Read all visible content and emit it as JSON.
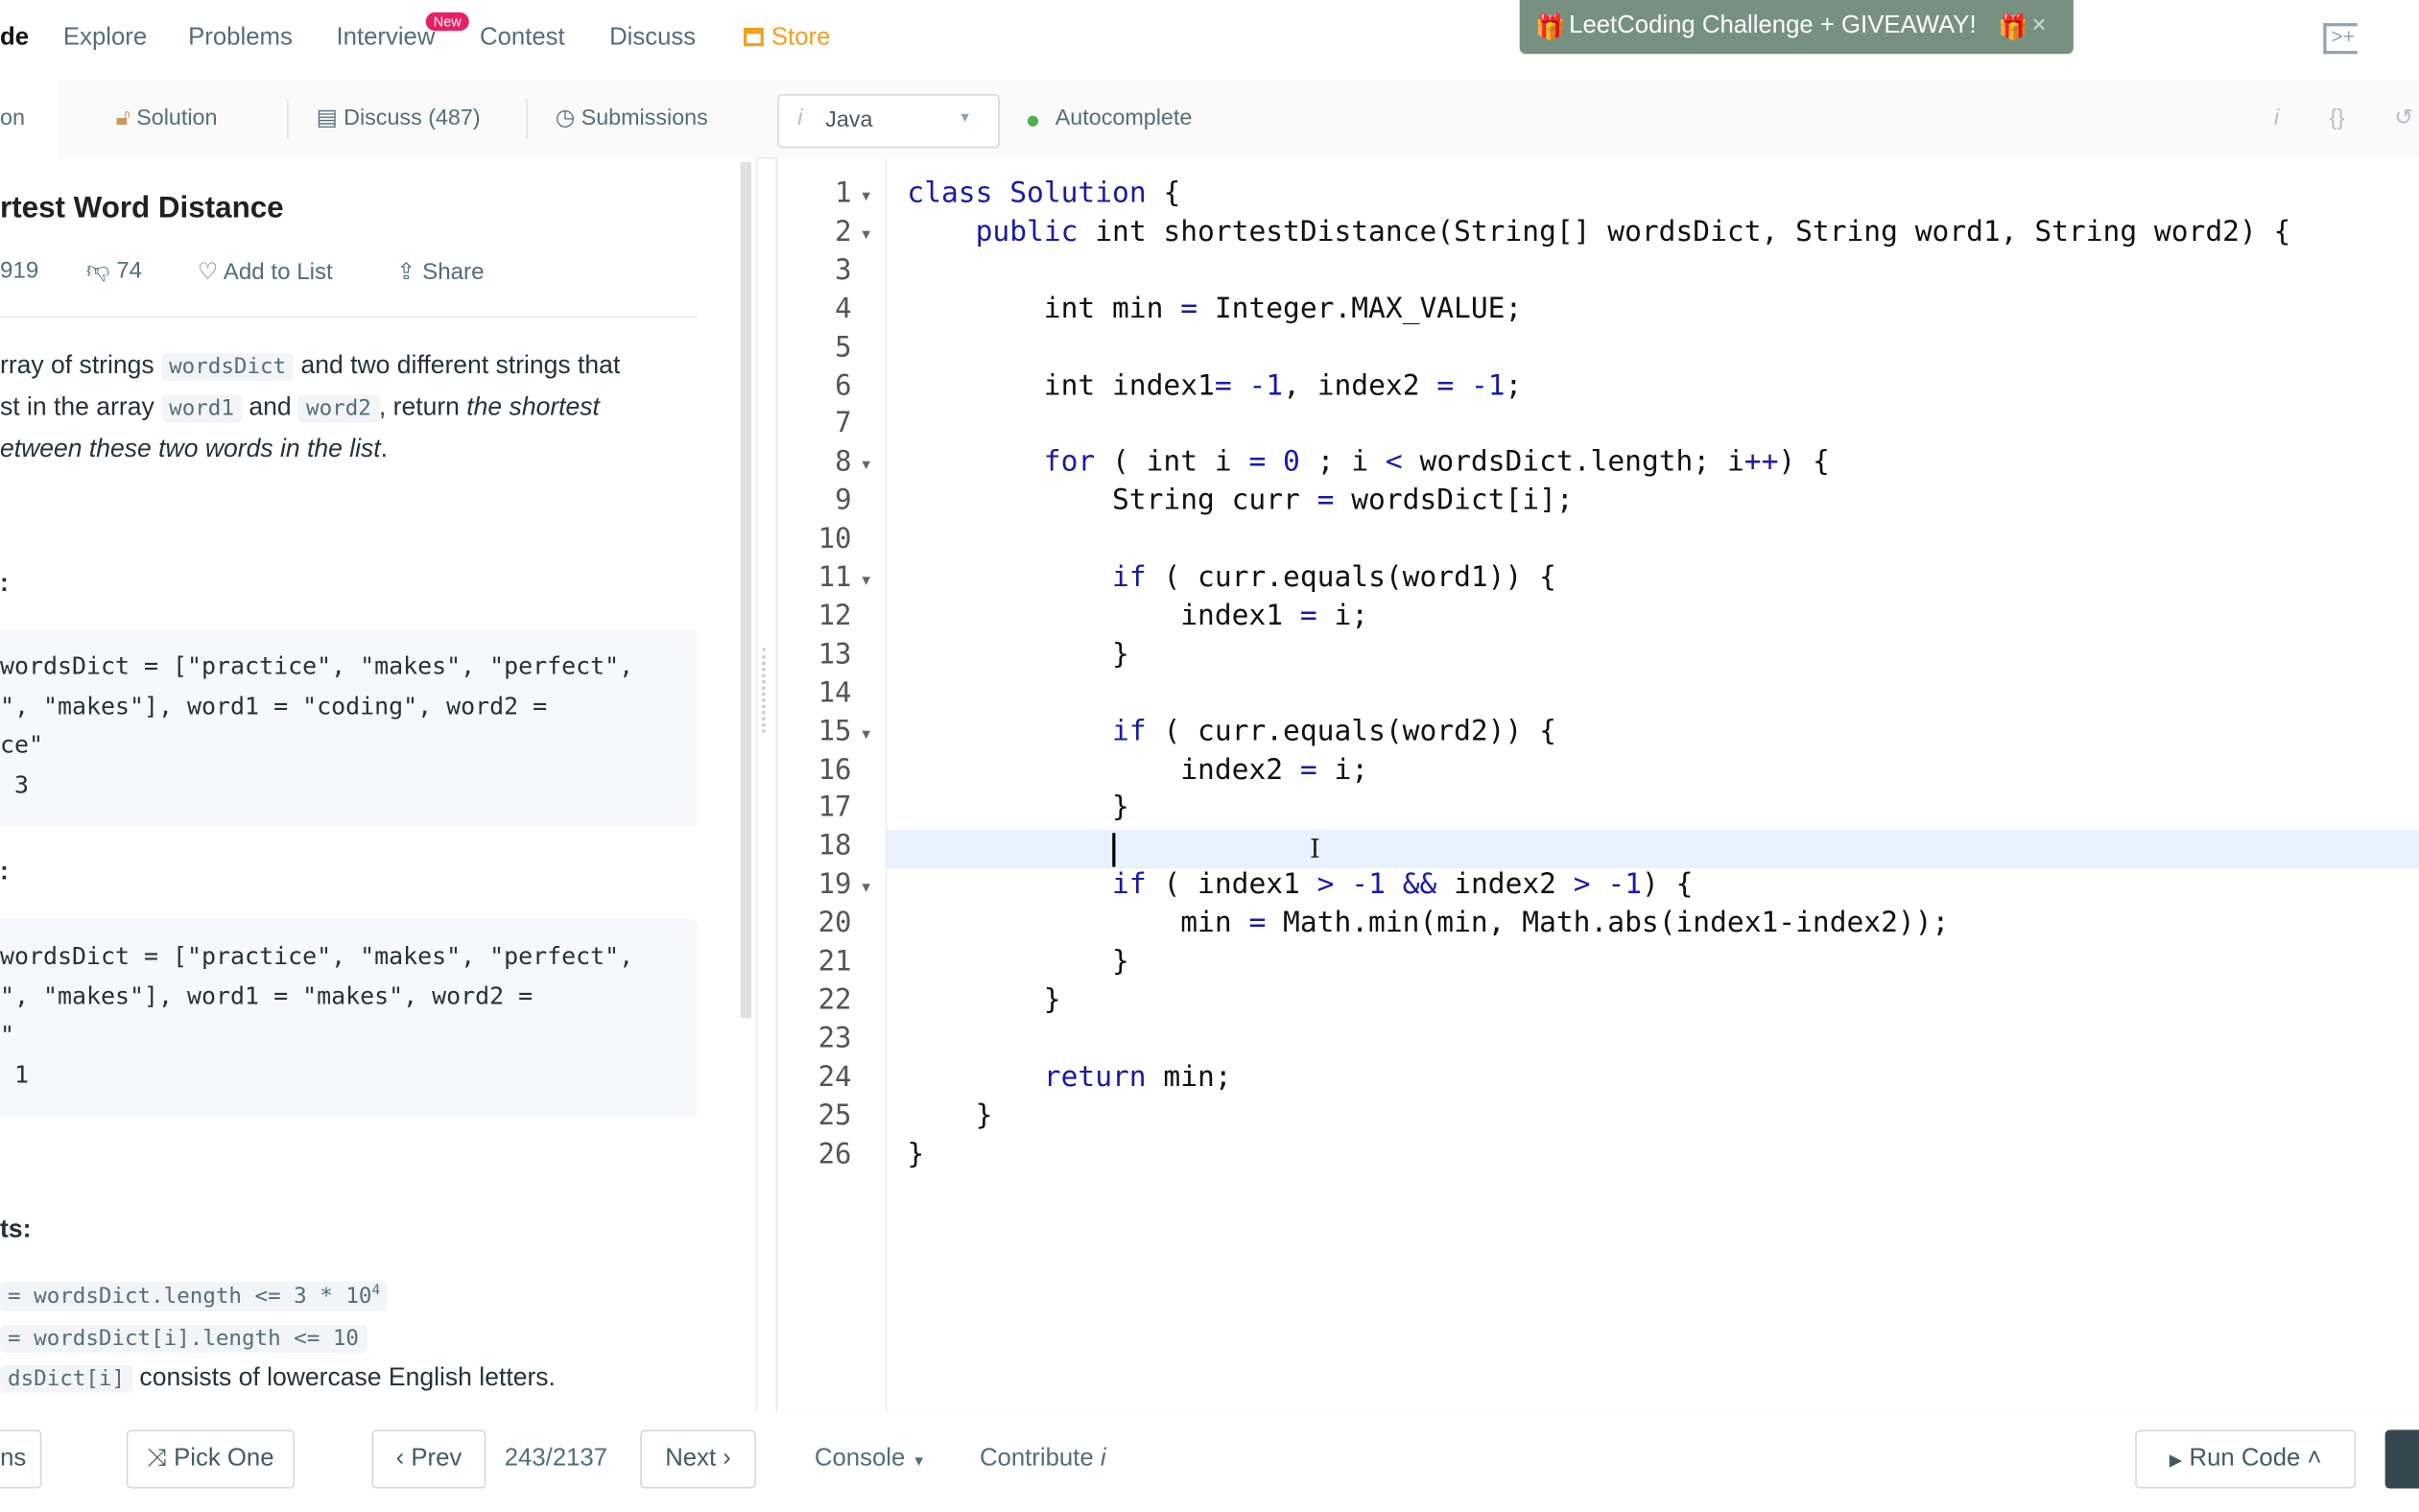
{
  "nav": {
    "logo_fragment": "de",
    "items": [
      "Explore",
      "Problems",
      "Interview",
      "Contest",
      "Discuss",
      "Store"
    ],
    "new_badge": "New",
    "store_color": "#f0a020",
    "banner": {
      "text": "LeetCoding Challenge + GIVEAWAY!",
      "close": "×",
      "color": "#789080"
    }
  },
  "tabs": {
    "description_fragment": "on",
    "solution": "Solution",
    "discuss": "Discuss (487)",
    "submissions": "Submissions",
    "language": "Java",
    "language_icon": "i",
    "autocomplete": "Autocomplete",
    "autocomplete_status_color": "#4caf50",
    "tools": {
      "info": "i",
      "format": "{}"
    }
  },
  "problem": {
    "title": "rtest Word Distance",
    "likes": "919",
    "dislikes": "74",
    "add_to_list": "Add to List",
    "share": "Share",
    "desc": {
      "l1a": "rray of strings",
      "l1code": "wordsDict",
      "l1b": "and two different strings that",
      "l2a": "st in the array",
      "l2code1": "word1",
      "l2b": "and",
      "l2code2": "word2",
      "l2c": ", return",
      "l2em": "the shortest",
      "l3em": "etween these two words in the list",
      "l3end": "."
    },
    "example1": {
      "heading": ":",
      "lines": [
        "wordsDict = [\"practice\", \"makes\", \"perfect\",",
        "\", \"makes\"], word1 = \"coding\", word2 =",
        "ce\"",
        " 3"
      ]
    },
    "example2": {
      "heading": ":",
      "lines": [
        "wordsDict = [\"practice\", \"makes\", \"perfect\",",
        "\", \"makes\"], word1 = \"makes\", word2 =",
        "\"",
        " 1"
      ]
    },
    "constraints": {
      "heading": "ts:",
      "c1": "= wordsDict.length <= 3 * 10",
      "c1sup": "4",
      "c2": "= wordsDict[i].length <= 10",
      "c3code": "dsDict[i]",
      "c3": "consists of lowercase English letters."
    }
  },
  "editor": {
    "current_line": 18,
    "code": [
      "class Solution {",
      "    public int shortestDistance(String[] wordsDict, String word1, String word2) {",
      "",
      "        int min = Integer.MAX_VALUE;",
      "",
      "        int index1= -1, index2 = -1;",
      "",
      "        for ( int i = 0 ; i < wordsDict.length; i++) {",
      "            String curr = wordsDict[i];",
      "",
      "            if ( curr.equals(word1)) {",
      "                index1 = i;",
      "            }",
      "",
      "            if ( curr.equals(word2)) {",
      "                index2 = i;",
      "            }",
      "",
      "            if ( index1 > -1 && index2 > -1) {",
      "                min = Math.min(min, Math.abs(index1-index2));",
      "            }",
      "        }",
      "",
      "        return min;",
      "    }",
      "}"
    ],
    "foldable_lines": [
      1,
      2,
      8,
      11,
      15,
      19
    ]
  },
  "bottom": {
    "problems_fragment": "ns",
    "pick_one": "Pick One",
    "prev": "Prev",
    "page": "243/2137",
    "next": "Next",
    "console": "Console",
    "contribute": "Contribute",
    "contribute_icon": "i",
    "run_code": "Run Code"
  }
}
